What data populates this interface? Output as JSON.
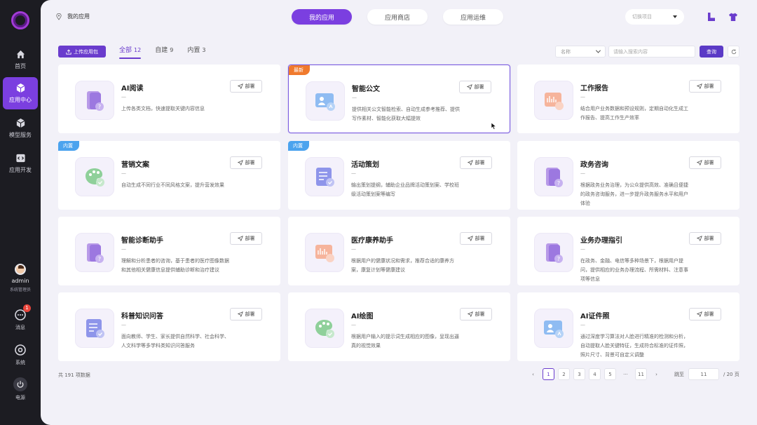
{
  "sidebar": {
    "items": [
      {
        "label": "首页",
        "icon": "home-icon"
      },
      {
        "label": "应用中心",
        "icon": "cube-icon",
        "active": true
      },
      {
        "label": "模型服务",
        "icon": "model-box-icon"
      },
      {
        "label": "应用开发",
        "icon": "code-icon"
      }
    ],
    "user": {
      "name": "admin",
      "role": "系统管理员"
    },
    "bottom": [
      {
        "label": "消息",
        "icon": "message-icon",
        "badge": "1"
      },
      {
        "label": "系统",
        "icon": "settings-icon"
      },
      {
        "label": "电源",
        "icon": "power-icon"
      }
    ]
  },
  "header": {
    "location": "我的应用",
    "tabs": [
      {
        "label": "我的应用",
        "active": true
      },
      {
        "label": "应用商店"
      },
      {
        "label": "应用运维"
      }
    ],
    "project_placeholder": "切换项目"
  },
  "toolbar": {
    "upload_label": "上传应用包",
    "filters": [
      {
        "label": "全部",
        "count": "12",
        "active": true
      },
      {
        "label": "自建",
        "count": "9"
      },
      {
        "label": "内置",
        "count": "3"
      }
    ],
    "search_field": "名称",
    "search_placeholder": "请输入搜索内容",
    "query_label": "查询"
  },
  "deploy_label": "部署",
  "cards": [
    {
      "title": "AI阅读",
      "dash": "—",
      "desc": "上传各类文档，快速提取关键内容信息",
      "icon": "book-icon",
      "tag": ""
    },
    {
      "title": "智能公文",
      "dash": "—",
      "desc": "提供相关公文智能检索、自动生成参考推荐、提供写作素材、智能化获取大幅提效",
      "icon": "id-photo-icon",
      "tag": "最新"
    },
    {
      "title": "工作报告",
      "dash": "—",
      "desc": "结合用户业务数据和预设规则，定期自动化生成工作报告、提高工作生产效率",
      "icon": "report-icon",
      "tag": ""
    },
    {
      "title": "营销文案",
      "dash": "—",
      "desc": "自动生成不同行业不同风格文案，提升营发效果",
      "icon": "palette-icon",
      "tag": "内置"
    },
    {
      "title": "活动策划",
      "dash": "—",
      "desc": "输出策划提纲，辅助企业品牌活动策划案、学校班级活动策划案等编写",
      "icon": "doc-check-icon",
      "tag": "内置"
    },
    {
      "title": "政务咨询",
      "dash": "—",
      "desc": "根据政务业务治理，为公众提供高效、准确且便捷的政务咨询服务，进一步提升政务服务水平和用户体验",
      "icon": "book-icon",
      "tag": ""
    },
    {
      "title": "智能诊断助手",
      "dash": "—",
      "desc": "理解和分析患者的咨询，基于患者的医疗图像数据和其他相关健康信息提供辅助诊断和治疗建议",
      "icon": "book-icon",
      "tag": ""
    },
    {
      "title": "医疗康养助手",
      "dash": "—",
      "desc": "根据用户的健康状况和需求，推荐合适的康养方案，康复计划等健康建议",
      "icon": "report-icon",
      "tag": ""
    },
    {
      "title": "业务办理指引",
      "dash": "—",
      "desc": "在政务、金融、电信等多种场景下，根据用户提问，提供相应的业务办理流程、所需材料、注意事项等信息",
      "icon": "book-icon",
      "tag": ""
    },
    {
      "title": "科普知识问答",
      "dash": "—",
      "desc": "面向教师、学生、家长提供自然科学、社会科学、人文科学等多学科类知识问答服务",
      "icon": "doc-check-icon",
      "tag": ""
    },
    {
      "title": "AI绘图",
      "dash": "—",
      "desc": "根据用户输入的提示词生成相应的图像，呈现出逼真的视觉效果",
      "icon": "palette-icon",
      "tag": ""
    },
    {
      "title": "AI证件照",
      "dash": "—",
      "desc": "通过深度学习算法对人脸进行精准的检测和分析，自动提取人脸关键特征，生成符合标准的证件照，照片尺寸、背景可自定义调整",
      "icon": "id-photo-icon",
      "tag": ""
    }
  ],
  "footer": {
    "total": "共 191 项数据",
    "pages": [
      "1",
      "2",
      "3",
      "4",
      "5",
      "···",
      "11"
    ],
    "current": "1",
    "jump_label": "跳至",
    "jump_value": "11",
    "page_total": "/ 20 页"
  },
  "colors": {
    "accent": "#7b3fe0",
    "sidebar_bg": "#1c1c22",
    "main_bg": "#f2f1f8",
    "tag_new": "#f07a2d",
    "tag_builtin": "#4ba3ee"
  }
}
